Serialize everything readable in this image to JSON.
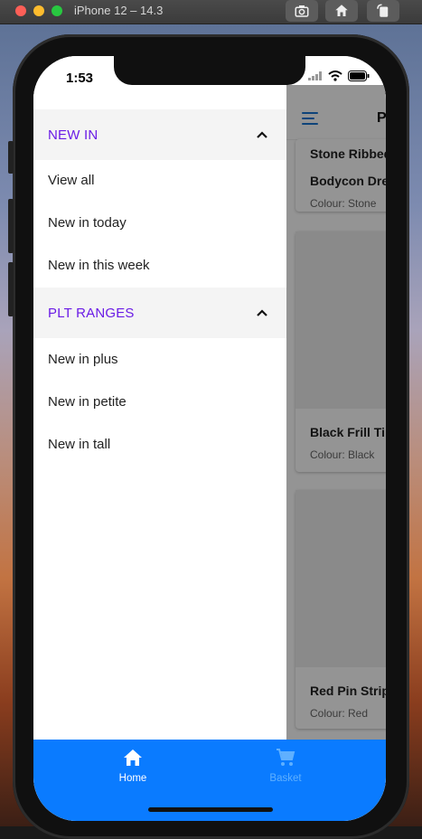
{
  "simulator": {
    "title": "iPhone 12 – 14.3",
    "buttons": [
      "screenshot",
      "home",
      "rotate"
    ]
  },
  "status_bar": {
    "time": "1:53"
  },
  "drawer": {
    "sections": [
      {
        "label": "NEW IN",
        "expanded": true,
        "items": [
          "View all",
          "New in today",
          "New in this week"
        ]
      },
      {
        "label": "PLT RANGES",
        "expanded": true,
        "items": [
          "New in plus",
          "New in petite",
          "New in tall"
        ]
      }
    ]
  },
  "page": {
    "title": "P",
    "products": [
      {
        "name_line1": "Stone Ribbed",
        "name_line2": "Bodycon Dre",
        "colour": "Colour: Stone"
      },
      {
        "name_line1": "Black Frill Ti",
        "colour": "Colour: Black"
      },
      {
        "name_line1": "Red Pin Strip",
        "colour": "Colour: Red"
      }
    ]
  },
  "bottom_nav": {
    "tabs": [
      {
        "label": "Home",
        "icon": "home-icon",
        "active": true
      },
      {
        "label": "Basket",
        "icon": "cart-icon",
        "active": false
      }
    ]
  },
  "colors": {
    "accent_purple": "#6a1be6",
    "nav_blue": "#0a7bff",
    "hamburger_blue": "#1976d2"
  }
}
